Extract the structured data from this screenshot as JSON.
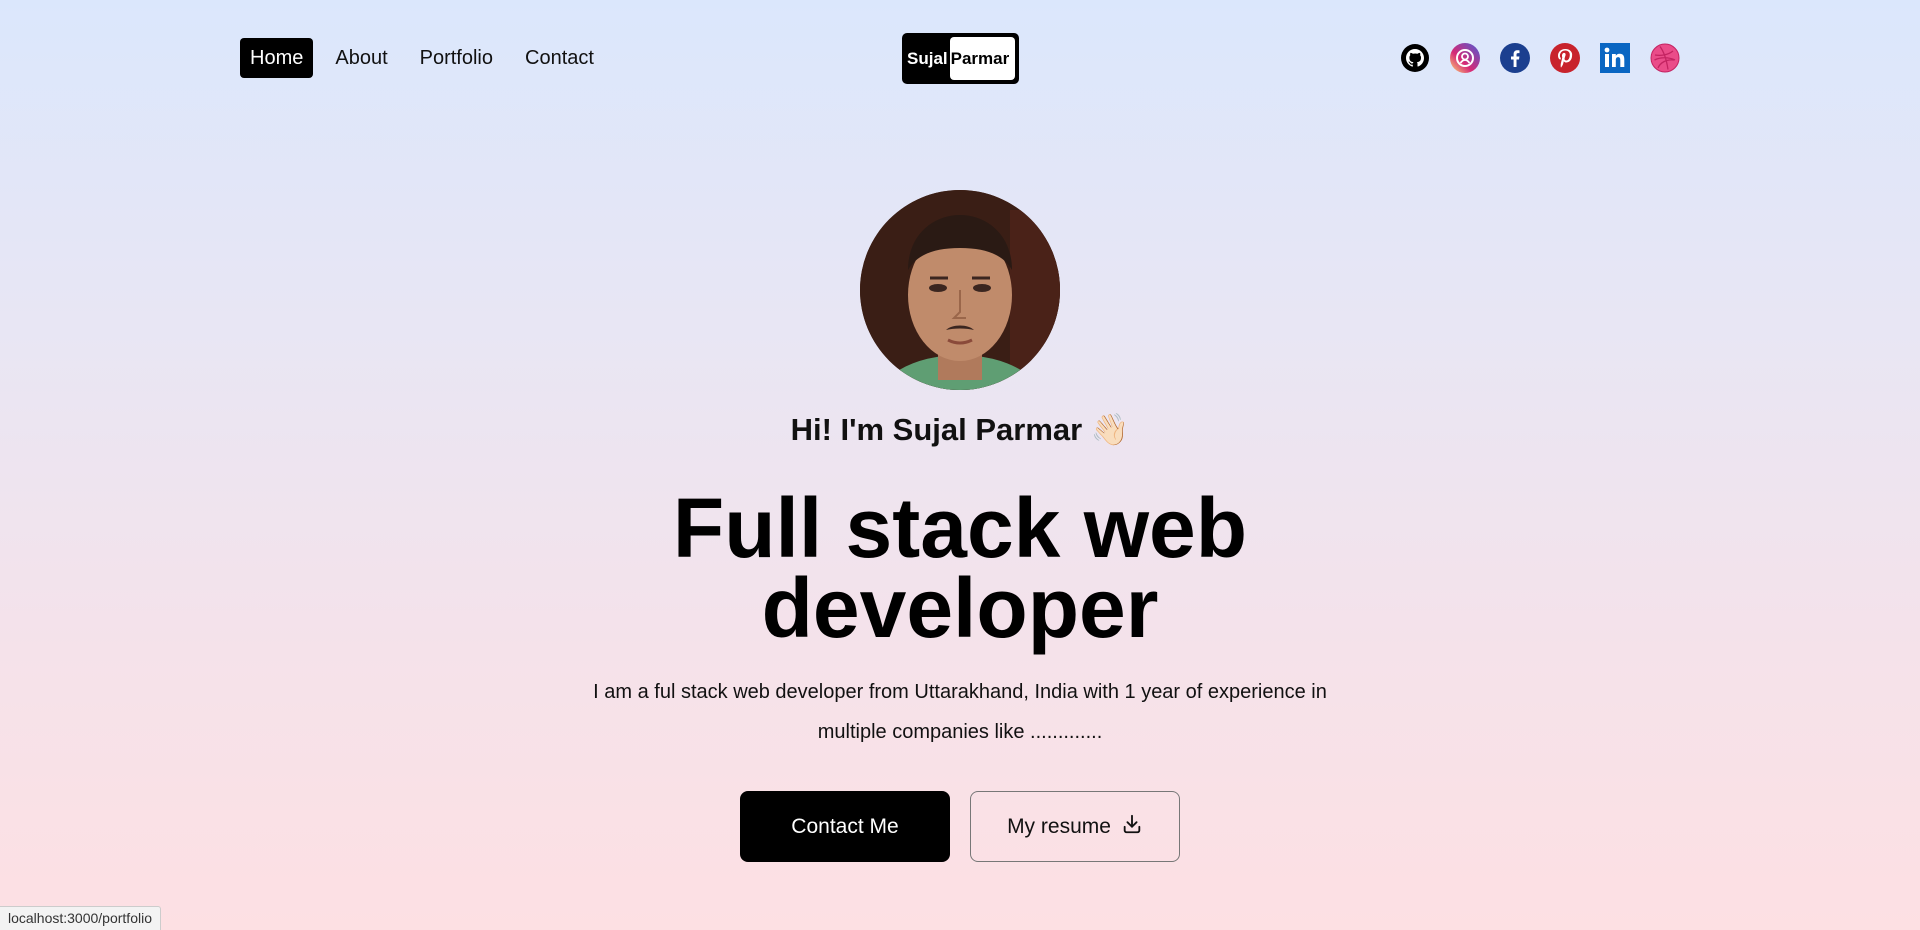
{
  "nav": {
    "items": [
      {
        "label": "Home",
        "active": true
      },
      {
        "label": "About",
        "active": false
      },
      {
        "label": "Portfolio",
        "active": false
      },
      {
        "label": "Contact",
        "active": false
      }
    ]
  },
  "logo": {
    "first": "Sujal",
    "last": "Parmar"
  },
  "socials": [
    {
      "icon": "github-icon",
      "color": "#000000"
    },
    {
      "icon": "threads-icon",
      "color": "#c13584"
    },
    {
      "icon": "facebook-icon",
      "color": "#1b3f8f"
    },
    {
      "icon": "pinterest-icon",
      "color": "#c8232c"
    },
    {
      "icon": "linkedin-icon",
      "color": "#0a66c2"
    },
    {
      "icon": "dribbble-icon",
      "color": "#ea4c89"
    }
  ],
  "hero": {
    "greeting": "Hi! I'm Sujal Parmar 👋🏻",
    "headline": "Full stack web developer",
    "intro": "I am a ful stack web developer from Uttarakhand, India with 1 year of experience in multiple companies like .............",
    "contact_label": "Contact Me",
    "resume_label": "My resume"
  },
  "status_bar": {
    "url": "localhost:3000/portfolio"
  }
}
